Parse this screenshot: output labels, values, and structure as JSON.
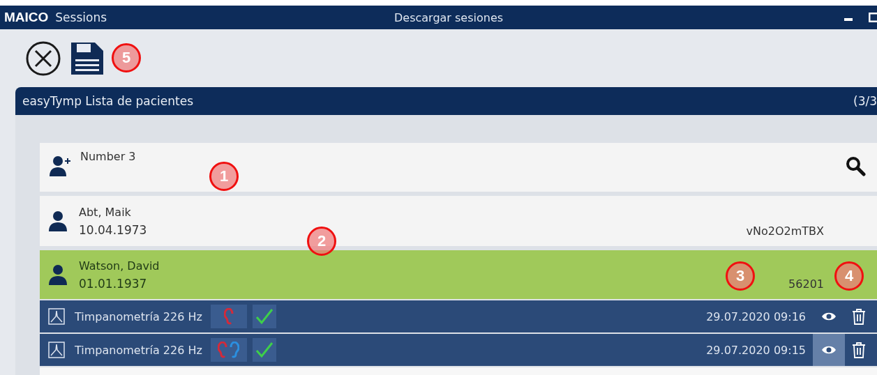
{
  "window": {
    "app": "MAICO",
    "section": "Sessions",
    "title": "Descargar sesiones"
  },
  "panel": {
    "title": "easyTymp Lista de pacientes",
    "count": "(3/3"
  },
  "search": {
    "value": "Number 3"
  },
  "patients": [
    {
      "name": "Abt, Maik",
      "birthdate": "10.04.1973",
      "id": "vNo2O2mTBX",
      "selected": false
    },
    {
      "name": "Watson, David",
      "birthdate": "01.01.1937",
      "id": "56201",
      "selected": true
    }
  ],
  "sessions": [
    {
      "test": "Timpanometría 226 Hz",
      "right_ear": true,
      "left_ear": false,
      "passed": true,
      "datetime": "29.07.2020 09:16",
      "view_selected": false
    },
    {
      "test": "Timpanometría 226 Hz",
      "right_ear": true,
      "left_ear": true,
      "passed": true,
      "datetime": "29.07.2020 09:15",
      "view_selected": true
    }
  ],
  "callouts": [
    {
      "label": "1"
    },
    {
      "label": "2"
    },
    {
      "label": "3"
    },
    {
      "label": "4"
    },
    {
      "label": "5"
    }
  ]
}
